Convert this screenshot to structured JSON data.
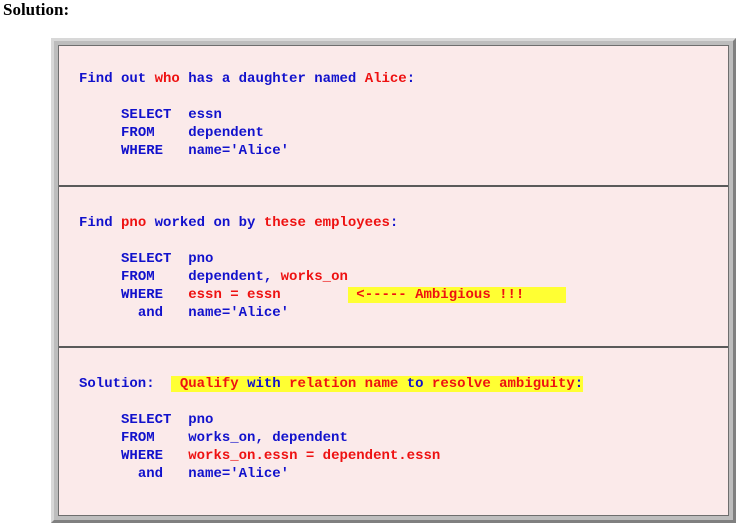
{
  "heading": "Solution:",
  "section1": {
    "intro": {
      "w1": "Find out ",
      "w2": "who",
      "w3": " has a daughter named ",
      "w4": "Alice",
      "w5": ":"
    },
    "select_kw": "SELECT",
    "select_val": "essn",
    "from_kw": "FROM",
    "from_val": "dependent",
    "where_kw": "WHERE",
    "where_val": "name='Alice'"
  },
  "section2": {
    "intro": {
      "w1": "Find ",
      "w2": "pno",
      "w3": " worked on by ",
      "w4": "these employees",
      "w5": ":"
    },
    "select_kw": "SELECT",
    "select_val": "pno",
    "from_kw": "FROM",
    "from_val1": "dependent, ",
    "from_val2": "works_on",
    "where_kw": "WHERE",
    "where_val": "essn = essn",
    "annotation": " <----- Ambigious !!!     ",
    "and_kw": "and",
    "and_val": "name='Alice'"
  },
  "section3": {
    "label": "Solution:",
    "hl": {
      "w1": " Qualify ",
      "w2": "with",
      "w3": " relation name ",
      "w4": "to",
      "w5": " resolve ambiguity",
      "w6": ":"
    },
    "select_kw": "SELECT",
    "select_val": "pno",
    "from_kw": "FROM",
    "from_val": "works_on, dependent",
    "where_kw": "WHERE",
    "where_val": "works_on.essn = dependent.essn",
    "and_kw": "and",
    "and_val": "name='Alice'"
  },
  "colors": {
    "keyword_blue": "#1111cc",
    "emphasis_red": "#ee1111",
    "highlight_yellow": "#ffff33",
    "panel_pink": "#fbeaea"
  }
}
